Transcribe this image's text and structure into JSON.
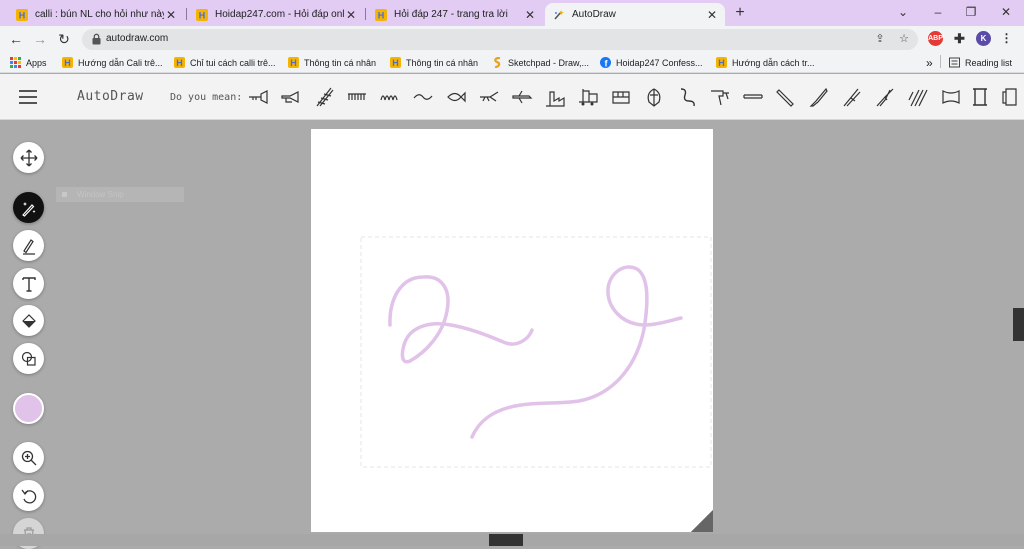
{
  "browser": {
    "tabs": [
      {
        "title": "calli : bún NL cho hỏi như này phải",
        "favicon": "hoidap-icon",
        "active": false
      },
      {
        "title": "Hoidap247.com - Hỏi đáp online",
        "favicon": "hoidap-icon",
        "active": false
      },
      {
        "title": "Hỏi đáp 247 - trang tra lời",
        "favicon": "hoidap-icon",
        "active": false
      },
      {
        "title": "AutoDraw",
        "favicon": "autodraw-icon",
        "active": true
      }
    ],
    "new_tab_label": "+",
    "url": "autodraw.com",
    "profile_initial": "K",
    "abp_label": "ABP",
    "bookmarks": [
      {
        "label": "Apps",
        "icon": "apps-grid-icon"
      },
      {
        "label": "Hướng dẫn Cali trê...",
        "icon": "hoidap-icon"
      },
      {
        "label": "Chỉ tui cách calli trê...",
        "icon": "hoidap-icon"
      },
      {
        "label": "Thông tin cá nhân",
        "icon": "hoidap-icon"
      },
      {
        "label": "Thông tin cá nhân",
        "icon": "hoidap-icon"
      },
      {
        "label": "Sketchpad - Draw,...",
        "icon": "sketchpad-icon"
      },
      {
        "label": "Hoidap247 Confess...",
        "icon": "facebook-icon"
      },
      {
        "label": "Hướng dẫn cách tr...",
        "icon": "hoidap-icon"
      }
    ],
    "overflow_label": "»",
    "reading_list_label": "Reading list"
  },
  "autodraw": {
    "brand": "AutoDraw",
    "do_you_mean": "Do you mean:",
    "suggestions": [
      "trumpet",
      "horn",
      "tower",
      "teeth",
      "wave",
      "hair",
      "fish",
      "bird",
      "airplane",
      "jet",
      "factory",
      "train",
      "bus",
      "shell",
      "snake",
      "drill",
      "hose",
      "pencil",
      "knife",
      "tweezers",
      "pliers",
      "cannon",
      "rain",
      "tube",
      "frame",
      "scroll"
    ],
    "tools": [
      "move-tool",
      "autodraw-tool",
      "draw-tool",
      "type-tool",
      "fill-tool",
      "shape-tool"
    ],
    "active_tool": "autodraw-tool",
    "color": "#e1c2e9",
    "zoom_tools": [
      "zoom-tool",
      "undo-tool",
      "delete-tool"
    ],
    "snip_label": "Window Snip"
  },
  "colors": {
    "tab_bar": "#e3ccf3",
    "stroke": "#e1c2e9",
    "workspace": "#ababab"
  }
}
